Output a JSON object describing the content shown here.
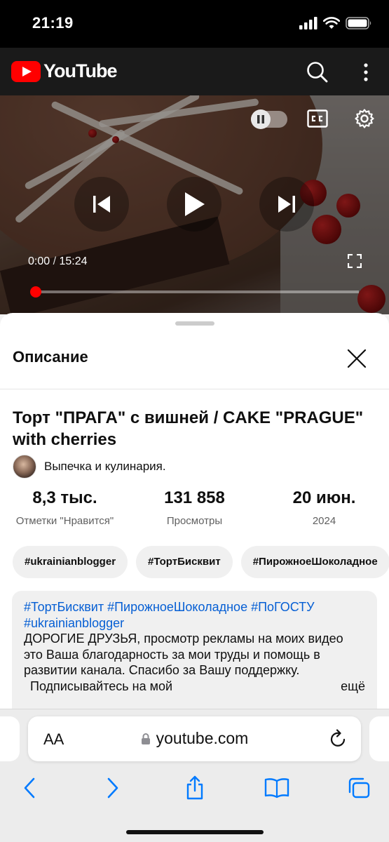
{
  "status_bar": {
    "time": "21:19"
  },
  "header": {
    "logo_text": "YouTube",
    "brand_color": "#ff0000"
  },
  "player": {
    "current_time": "0:00",
    "separator": "/",
    "duration": "15:24",
    "progress_fraction": 0.0,
    "progress_color": "#ff0000"
  },
  "description_panel": {
    "heading": "Описание",
    "video_title": "Торт \"ПРАГА\" с вишней / CAKE \"PRAGUE\" with cherries",
    "channel_name": "Выпечка и кулинария.",
    "stats": [
      {
        "value": "8,3 тыс.",
        "label": "Отметки \"Нравится\""
      },
      {
        "value": "131 858",
        "label": "Просмотры"
      },
      {
        "value": "20 июн.",
        "label": "2024"
      }
    ],
    "tags": [
      "#ukrainianblogger",
      "#ТортБисквит",
      "#ПирожноеШоколадное"
    ],
    "description": {
      "hashtags_line1": "#ТортБисквит #ПирожноеШоколадное #ПоГОСТУ",
      "hashtags_line2": "#ukrainianblogger",
      "text": "ДОРОГИЕ ДРУЗЬЯ, просмотр рекламы на моих видео это Ваша благодарность за мои труды и помощь в развитии канала. Спасибо за Вашу поддержку.",
      "partial_line": "Подписывайтесь на мой",
      "more_hint": "ещё"
    },
    "hashtag_color": "#065fd4"
  },
  "browser": {
    "text_size_label": "AA",
    "url": "youtube.com",
    "accent_color": "#007aff"
  }
}
